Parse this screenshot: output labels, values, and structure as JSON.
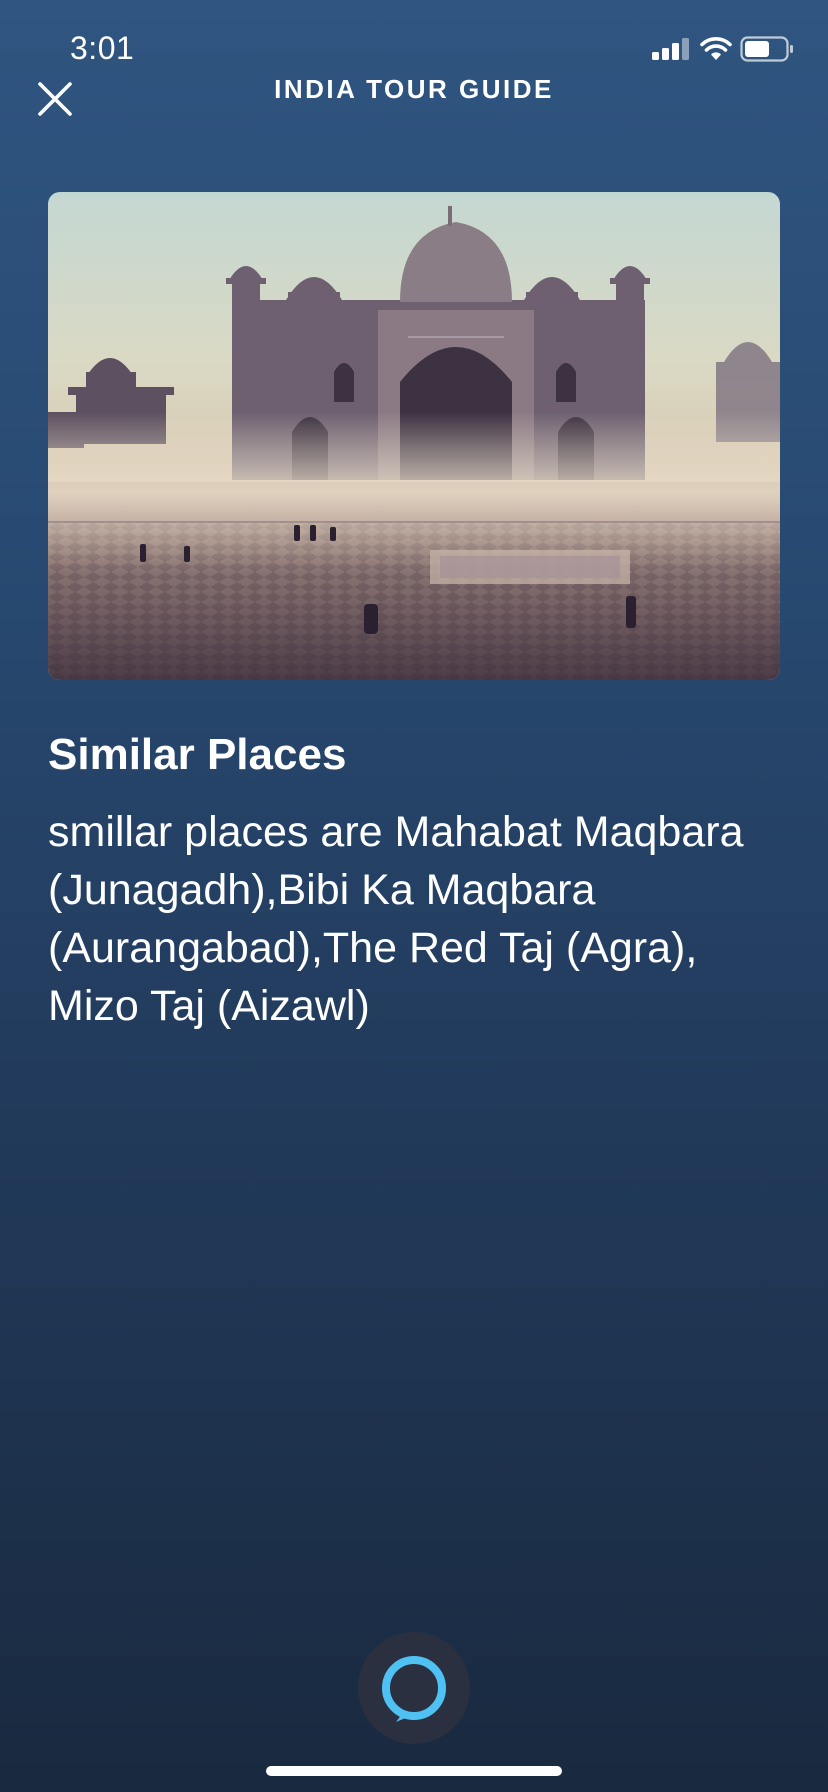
{
  "status_bar": {
    "time": "3:01"
  },
  "header": {
    "title": "INDIA TOUR GUIDE",
    "close_icon": "close-icon"
  },
  "hero": {
    "subject": "taj-mahal-in-mist"
  },
  "content": {
    "title": "Similar Places",
    "body": "smillar places are Mahabat Maqbara (Junagadh),Bibi Ka Maqbara (Aurangabad),The Red Taj (Agra), Mizo Taj (Aizawl)"
  },
  "alexa": {
    "icon": "alexa-ring-icon",
    "ring_color": "#4fc1f3"
  },
  "colors": {
    "background_top": "#2f5580",
    "background_bottom": "#19293f"
  }
}
